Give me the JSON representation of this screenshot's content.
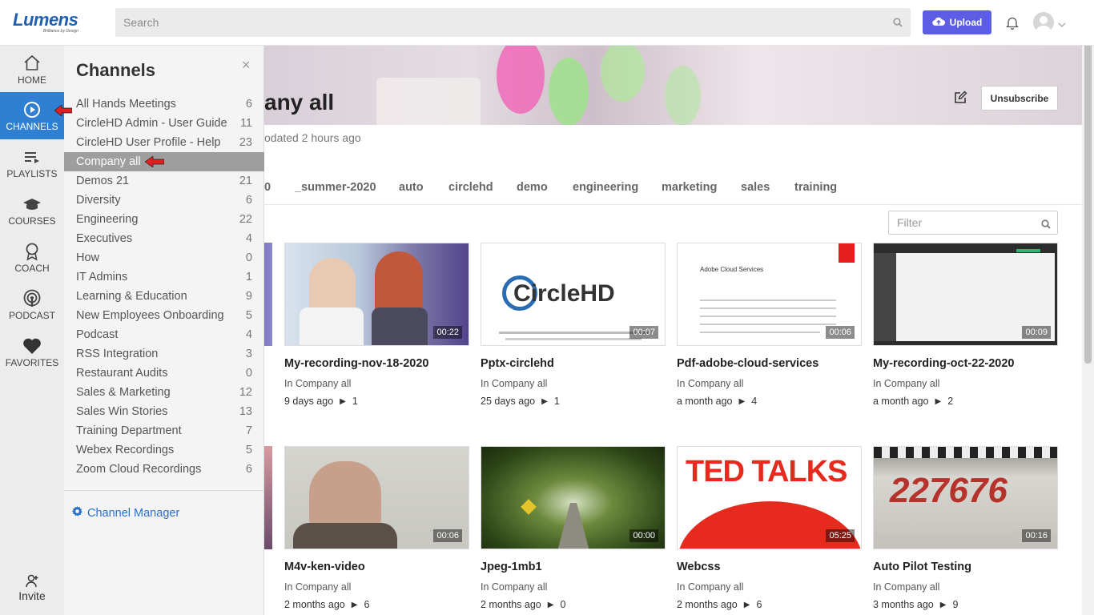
{
  "header": {
    "logo_text": "Lumens",
    "logo_tagline": "Brilliance by Design",
    "search_placeholder": "Search",
    "upload_label": "Upload"
  },
  "nav": {
    "items": [
      {
        "label": "HOME",
        "icon": "home-icon"
      },
      {
        "label": "CHANNELS",
        "icon": "play-circle-icon"
      },
      {
        "label": "PLAYLISTS",
        "icon": "playlist-icon"
      },
      {
        "label": "COURSES",
        "icon": "graduation-cap-icon"
      },
      {
        "label": "COACH",
        "icon": "award-ribbon-icon"
      },
      {
        "label": "PODCAST",
        "icon": "podcast-icon"
      },
      {
        "label": "FAVORITES",
        "icon": "heart-icon"
      }
    ],
    "invite_label": "Invite"
  },
  "drawer": {
    "title": "Channels",
    "close": "×",
    "channels": [
      {
        "name": "All Hands Meetings",
        "count": "6"
      },
      {
        "name": "CircleHD Admin - User Guide",
        "count": "11"
      },
      {
        "name": "CircleHD User Profile - Help",
        "count": "23"
      },
      {
        "name": "Company all",
        "count": ""
      },
      {
        "name": "Demos 21",
        "count": "21"
      },
      {
        "name": "Diversity",
        "count": "6"
      },
      {
        "name": "Engineering",
        "count": "22"
      },
      {
        "name": "Executives",
        "count": "4"
      },
      {
        "name": "How",
        "count": "0"
      },
      {
        "name": "IT Admins",
        "count": "1"
      },
      {
        "name": "Learning & Education",
        "count": "9"
      },
      {
        "name": "New Employees Onboarding",
        "count": "5"
      },
      {
        "name": "Podcast",
        "count": "4"
      },
      {
        "name": "RSS Integration",
        "count": "3"
      },
      {
        "name": "Restaurant Audits",
        "count": "0"
      },
      {
        "name": "Sales & Marketing",
        "count": "12"
      },
      {
        "name": "Sales Win Stories",
        "count": "13"
      },
      {
        "name": "Training Department",
        "count": "7"
      },
      {
        "name": "Webex Recordings",
        "count": "5"
      },
      {
        "name": "Zoom Cloud Recordings",
        "count": "6"
      }
    ],
    "manager_label": "Channel Manager"
  },
  "channel": {
    "title_visible": "any all",
    "updated": "odated 2 hours ago",
    "unsubscribe_label": "Unsubscribe",
    "tags": [
      "0",
      "_summer-2020",
      "auto",
      "circlehd",
      "demo",
      "engineering",
      "marketing",
      "sales",
      "training"
    ],
    "filter_placeholder": "Filter"
  },
  "videos": [
    {
      "title": "My-recording-nov-18-2020",
      "channel": "In Company all",
      "age": "9 days ago",
      "plays": "1",
      "duration": "00:22"
    },
    {
      "title": "Pptx-circlehd",
      "channel": "In Company all",
      "age": "25 days ago",
      "plays": "1",
      "duration": "00:07",
      "thumb_text": "CircleHD"
    },
    {
      "title": "Pdf-adobe-cloud-services",
      "channel": "In Company all",
      "age": "a month ago",
      "plays": "4",
      "duration": "00:06",
      "thumb_text": "Adobe Cloud Services"
    },
    {
      "title": "My-recording-oct-22-2020",
      "channel": "In Company all",
      "age": "a month ago",
      "plays": "2",
      "duration": "00:09"
    },
    {
      "title": "M4v-ken-video",
      "channel": "In Company all",
      "age": "2 months ago",
      "plays": "6",
      "duration": "00:06"
    },
    {
      "title": "Jpeg-1mb1",
      "channel": "In Company all",
      "age": "2 months ago",
      "plays": "0",
      "duration": "00:00"
    },
    {
      "title": "Webcss",
      "channel": "In Company all",
      "age": "2 months ago",
      "plays": "6",
      "duration": "05:25",
      "thumb_text": "TED TALKS"
    },
    {
      "title": "Auto Pilot Testing",
      "channel": "In Company all",
      "age": "3 months ago",
      "plays": "9",
      "duration": "00:16",
      "thumb_text": "227676"
    }
  ],
  "colors": {
    "accent": "#5b5ee5",
    "nav_active": "#2f7fd3",
    "drawer_active": "#9e9e9e",
    "link": "#2c6fc8",
    "arrow": "#e02020"
  }
}
